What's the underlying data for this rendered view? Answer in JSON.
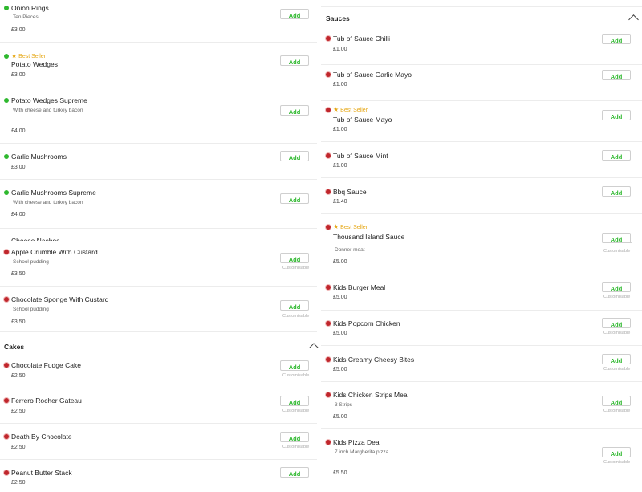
{
  "add_label": "Add",
  "customisable_label": "Customisable",
  "best_seller_label": "Best Seller",
  "star_icon": "★",
  "colors": {
    "veg": "#2eb82e",
    "nonveg": "#c0262c",
    "accent": "#2eb82e",
    "best_seller": "#e6a817"
  },
  "left": {
    "items_top": [
      {
        "name": "Onion Rings",
        "desc": "Ten Pieces",
        "price": "£3.00",
        "veg": true
      },
      {
        "name": "Potato Wedges",
        "price": "£3.00",
        "veg": true,
        "best_seller": true
      },
      {
        "name": "Potato Wedges Supreme",
        "desc": "With cheese and turkey bacon",
        "price": "£4.00",
        "veg": true
      },
      {
        "name": "Garlic Mushrooms",
        "price": "£3.00",
        "veg": true
      },
      {
        "name": "Garlic Mushrooms Supreme",
        "desc": "With cheese and turkey bacon",
        "price": "£4.00",
        "veg": true
      }
    ],
    "partial_item": "Cheese Nachos",
    "items_desserts": [
      {
        "name": "Apple Crumble With Custard",
        "desc": "School pudding",
        "price": "£3.50",
        "veg": false,
        "customisable": true
      },
      {
        "name": "Chocolate Sponge With Custard",
        "desc": "School pudding",
        "price": "£3.50",
        "veg": false,
        "customisable": true
      }
    ],
    "section_cakes": "Cakes",
    "items_cakes": [
      {
        "name": "Chocolate Fudge Cake",
        "price": "£2.50",
        "veg": false,
        "customisable": true
      },
      {
        "name": "Ferrero Rocher Gateau",
        "price": "£2.50",
        "veg": false,
        "customisable": true
      },
      {
        "name": "Death By Chocolate",
        "price": "£2.50",
        "veg": false,
        "customisable": true
      },
      {
        "name": "Peanut Butter Stack",
        "price": "£2.50",
        "veg": false,
        "customisable": false
      }
    ]
  },
  "right": {
    "section_sauces": "Sauces",
    "items": [
      {
        "name": "Tub of Sauce Chilli",
        "price": "£1.00",
        "veg": false
      },
      {
        "name": "Tub of Sauce Garlic Mayo",
        "price": "£1.00",
        "veg": false
      },
      {
        "name": "Tub of Sauce Mayo",
        "price": "£1.00",
        "veg": false,
        "best_seller": true
      },
      {
        "name": "Tub of Sauce Mint",
        "price": "£1.00",
        "veg": false
      },
      {
        "name": "Bbq Sauce",
        "price": "£1.40",
        "veg": false
      },
      {
        "name": "Thousand Island Sauce",
        "desc": "Donner meat",
        "price": "£5.00",
        "veg": false,
        "best_seller": true,
        "customisable": true
      },
      {
        "name": "Kids Burger Meal",
        "price": "£5.00",
        "veg": false,
        "customisable": true
      },
      {
        "name": "Kids Popcorn Chicken",
        "price": "£5.00",
        "veg": false,
        "customisable": true
      },
      {
        "name": "Kids Creamy Cheesy Bites",
        "price": "£5.00",
        "veg": false,
        "customisable": true
      },
      {
        "name": "Kids Chicken Strips Meal",
        "desc": "3 Strips",
        "price": "£5.00",
        "veg": false,
        "customisable": true
      },
      {
        "name": "Kids Pizza Deal",
        "desc": "7 inch Margherita pizza",
        "price": "£5.50",
        "veg": false,
        "customisable": true
      }
    ]
  }
}
